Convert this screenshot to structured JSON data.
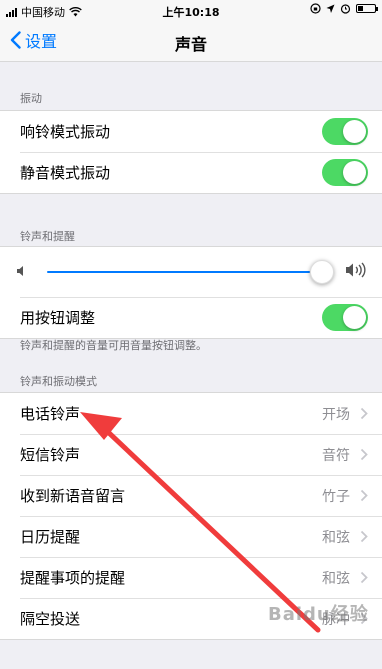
{
  "status_bar": {
    "carrier": "中国移动",
    "time": "上午10:18"
  },
  "nav": {
    "back_label": "设置",
    "title": "声音"
  },
  "sections": {
    "vibration": {
      "header": "振动",
      "rows": [
        {
          "label": "响铃模式振动",
          "on": true
        },
        {
          "label": "静音模式振动",
          "on": true
        }
      ]
    },
    "ringer": {
      "header": "铃声和提醒",
      "volume_level": 0.95,
      "change_with_buttons_label": "用按钮调整",
      "change_with_buttons_on": true,
      "footer": "铃声和提醒的音量可用音量按钮调整。"
    },
    "patterns": {
      "header": "铃声和振动模式",
      "rows": [
        {
          "label": "电话铃声",
          "value": "开场"
        },
        {
          "label": "短信铃声",
          "value": "音符"
        },
        {
          "label": "收到新语音留言",
          "value": "竹子"
        },
        {
          "label": "日历提醒",
          "value": "和弦"
        },
        {
          "label": "提醒事项的提醒",
          "value": "和弦"
        },
        {
          "label": "隔空投送",
          "value": "脉冲"
        }
      ]
    }
  },
  "watermark": "Baidu经验",
  "colors": {
    "accent": "#007aff",
    "toggle_on": "#4cd964",
    "annotation_arrow": "#f03c3c"
  }
}
